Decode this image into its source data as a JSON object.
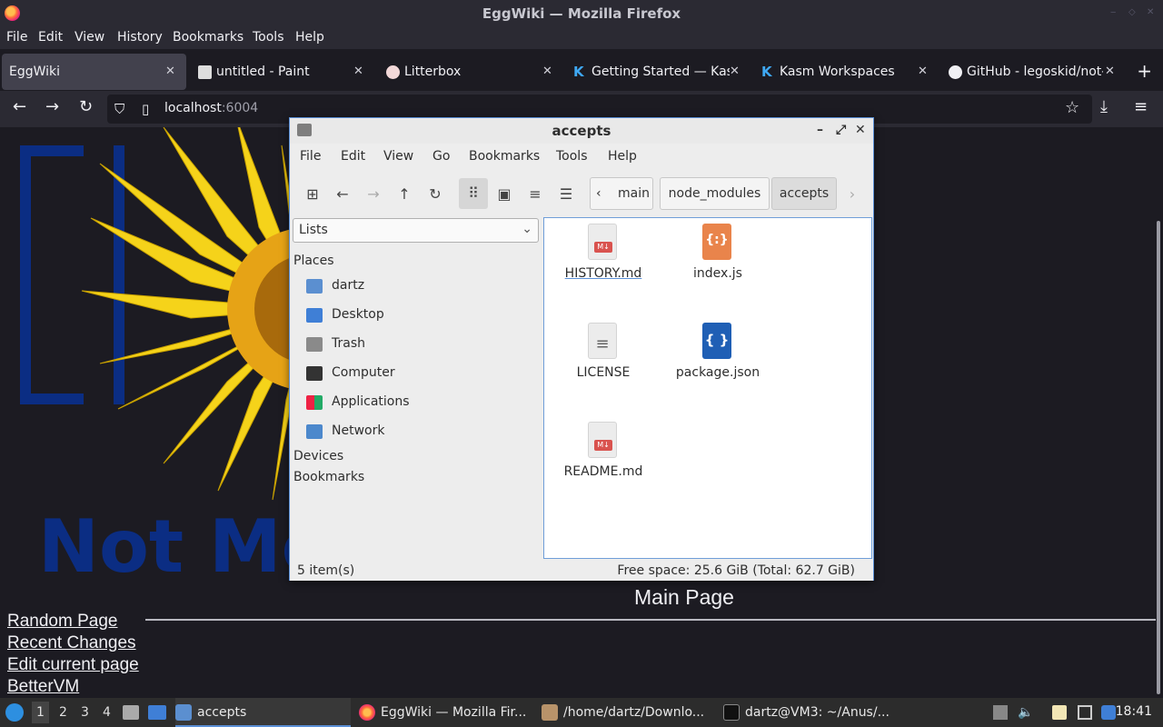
{
  "firefox": {
    "window_title": "EggWiki — Mozilla Firefox",
    "menu": [
      "File",
      "Edit",
      "View",
      "History",
      "Bookmarks",
      "Tools",
      "Help"
    ],
    "tabs": [
      {
        "label": "EggWiki",
        "active": true
      },
      {
        "label": "untitled - Paint",
        "active": false
      },
      {
        "label": "Litterbox",
        "active": false
      },
      {
        "label": "Getting Started — Kas",
        "active": false
      },
      {
        "label": "Kasm Workspaces",
        "active": false
      },
      {
        "label": "GitHub - legoskid/not-",
        "active": false
      }
    ],
    "url_host": "localhost",
    "url_port": ":6004"
  },
  "wiki": {
    "logo_text": "Not Me",
    "page_title": "Main Page",
    "links": [
      "Random Page",
      "Recent Changes",
      "Edit current page",
      "BetterVM"
    ]
  },
  "file_manager": {
    "window_title": "accepts",
    "menu": [
      "File",
      "Edit",
      "View",
      "Go",
      "Bookmarks",
      "Tools",
      "Help"
    ],
    "breadcrumbs": [
      "main",
      "node_modules",
      "accepts"
    ],
    "side_select": "Lists",
    "places_heading": "Places",
    "places": [
      {
        "label": "dartz",
        "icon": "home-folder-icon"
      },
      {
        "label": "Desktop",
        "icon": "desktop-icon"
      },
      {
        "label": "Trash",
        "icon": "trash-icon"
      },
      {
        "label": "Computer",
        "icon": "computer-icon"
      },
      {
        "label": "Applications",
        "icon": "applications-icon"
      },
      {
        "label": "Network",
        "icon": "network-icon"
      }
    ],
    "devices_heading": "Devices",
    "bookmarks_heading": "Bookmarks",
    "files": [
      {
        "name": "HISTORY.md",
        "type": "md"
      },
      {
        "name": "index.js",
        "type": "js"
      },
      {
        "name": "LICENSE",
        "type": "txt"
      },
      {
        "name": "package.json",
        "type": "json"
      },
      {
        "name": "README.md",
        "type": "md"
      }
    ],
    "status_count": "5 item(s)",
    "status_space": "Free space: 25.6 GiB (Total: 62.7 GiB)"
  },
  "taskbar": {
    "workspaces": [
      "1",
      "2",
      "3",
      "4"
    ],
    "tasks": [
      {
        "label": "accepts",
        "active": true
      },
      {
        "label": "EggWiki — Mozilla Fir...",
        "active": false
      },
      {
        "label": "/home/dartz/Downlo...",
        "active": false
      },
      {
        "label": "dartz@VM3: ~/Anus/...",
        "active": false
      }
    ],
    "clock": "18:41"
  }
}
